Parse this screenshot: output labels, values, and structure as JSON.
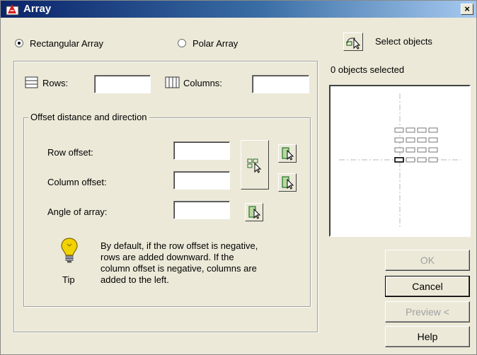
{
  "window": {
    "title": "Array",
    "close_label": "×"
  },
  "array_type": {
    "rectangular_label": "Rectangular Array",
    "polar_label": "Polar Array",
    "selected": "Rectangular Array"
  },
  "selection": {
    "select_objects_label": "Select objects",
    "status_text": "0 objects selected"
  },
  "grid": {
    "rows_label": "Rows:",
    "rows_value": "",
    "columns_label": "Columns:",
    "columns_value": ""
  },
  "offset": {
    "group_label": "Offset distance and direction",
    "row_offset_label": "Row offset:",
    "row_offset_value": "",
    "column_offset_label": "Column offset:",
    "column_offset_value": "",
    "angle_label": "Angle of array:",
    "angle_value": ""
  },
  "tip": {
    "label": "Tip",
    "line1": "By default, if the row offset is negative,",
    "line2": "rows are added downward.  If the",
    "line3": "column offset is negative, columns are",
    "line4": "added to the left."
  },
  "buttons": {
    "ok": "OK",
    "cancel": "Cancel",
    "preview": "Preview <",
    "help": "Help"
  },
  "colors": {
    "face": "#ece9d8",
    "title_start": "#0a246a",
    "title_end": "#a6caf0",
    "pick_green": "#2e7d32",
    "tip_yellow": "#f2d200"
  },
  "icons": [
    "app-icon",
    "close-icon",
    "select-objects-icon",
    "rows-icon",
    "columns-icon",
    "pick-both-offsets-icon",
    "pick-row-offset-icon",
    "pick-column-offset-icon",
    "pick-angle-icon",
    "tip-lightbulb-icon"
  ]
}
